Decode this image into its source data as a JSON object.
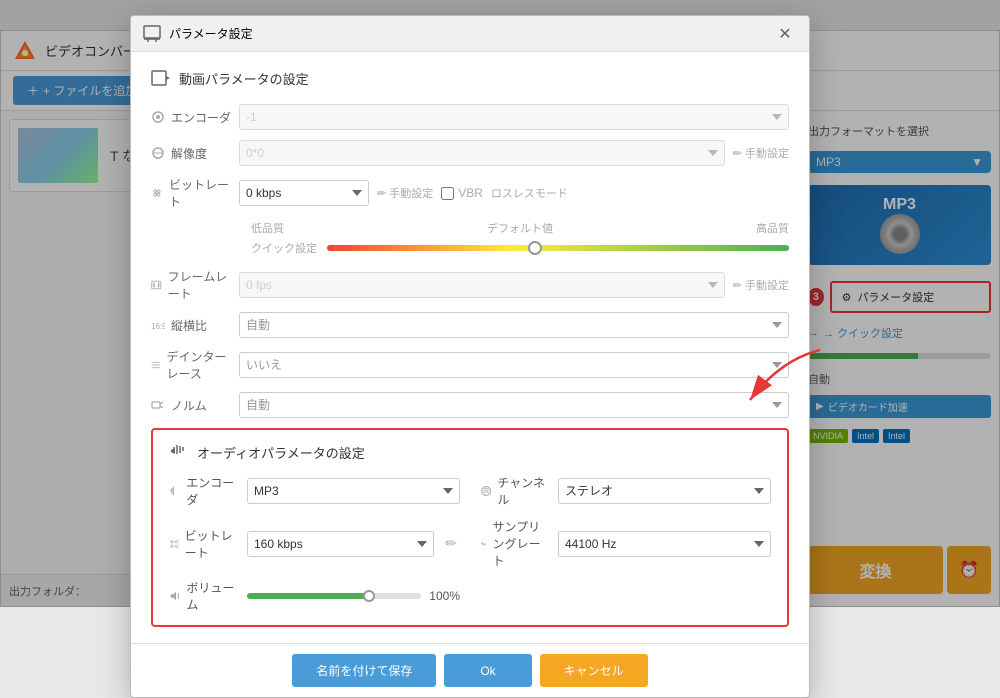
{
  "app": {
    "title": "ビデオコンバーター",
    "add_file_label": "+ ファイルを追加",
    "output_folder_label": "出力フォルダ：",
    "minimize_btn": "—",
    "close_btn": "✕"
  },
  "main_window": {
    "file_item": {
      "label": "T なし"
    }
  },
  "right_panel": {
    "format_section_title": "出力フォーマットを選択",
    "format_name": "MP3",
    "param_btn_label": "パラメータ設定",
    "quick_setting_label": "→ クイック設定",
    "auto_label": "自動",
    "gpu_btn_label": "ビデオカード加速",
    "nvidia_label": "NVIDIA",
    "intel_label1": "Intel",
    "intel_label2": "Intel",
    "convert_btn": "変換",
    "step_badge": "3"
  },
  "dialog": {
    "title": "パラメータ設定",
    "close_btn": "✕",
    "video_section_title": "動画パラメータの設定",
    "encoder_label": "エンコーダ",
    "encoder_value": "-1",
    "resolution_label": "解像度",
    "resolution_value": "0*0",
    "manual_btn1": "手動設定",
    "bitrate_label": "ビットレート",
    "bitrate_value": "0 kbps",
    "manual_btn2": "手動設定",
    "vbr_label": "VBR",
    "lossless_label": "ロスレスモード",
    "quality_low": "低品質",
    "quality_default": "デフォルト値",
    "quality_high": "高品質",
    "quick_setting_label": "クイック設定",
    "framerate_label": "フレームレート",
    "framerate_value": "0 fps",
    "manual_btn3": "手動設定",
    "aspect_label": "縦横比",
    "aspect_value": "自動",
    "deinterlace_label": "デインターレース",
    "deinterlace_value": "いいえ",
    "volume_label2": "ノルム",
    "volume_value": "自動",
    "audio_section_title": "オーディオパラメータの設定",
    "audio_encoder_label": "エンコーダ",
    "audio_encoder_value": "MP3",
    "audio_channel_label": "チャンネル",
    "audio_channel_value": "ステレオ",
    "audio_bitrate_label": "ビットレート",
    "audio_bitrate_value": "160 kbps",
    "audio_samplerate_label": "サンプリングレート",
    "audio_samplerate_value": "44100 Hz",
    "audio_volume_label": "ボリューム",
    "audio_volume_pct": "100%",
    "footer_save": "名前を付けて保存",
    "footer_ok": "Ok",
    "footer_cancel": "キャンセル"
  }
}
